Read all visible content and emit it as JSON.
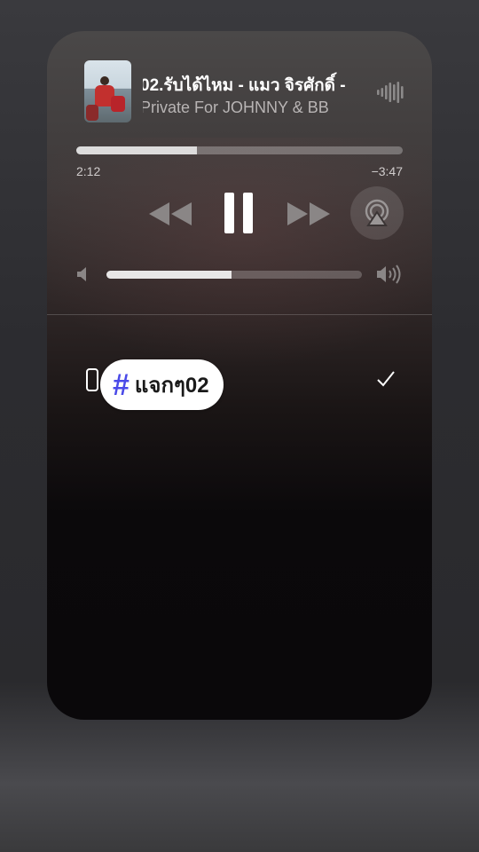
{
  "now_playing": {
    "title": "02.รับได้ไหม - แมว จิรศักดิ์ -",
    "subtitle": "Private For JOHNNY & BB",
    "progress_fraction": 0.37,
    "time_elapsed": "2:12",
    "time_remaining": "−3:47"
  },
  "controls": {
    "rewind_icon": "rewind-icon",
    "pause_icon": "pause-icon",
    "forward_icon": "fast-forward-icon",
    "airplay_icon": "airplay-icon"
  },
  "volume": {
    "level_fraction": 0.49
  },
  "device": {
    "icon": "iphone-icon",
    "selected": true
  },
  "tag": {
    "symbol": "#",
    "text": "แจกๆ02"
  },
  "colors": {
    "tag_hash": "#4a4ae8",
    "card_top": "#4a4848",
    "card_bottom": "#0a080a"
  }
}
